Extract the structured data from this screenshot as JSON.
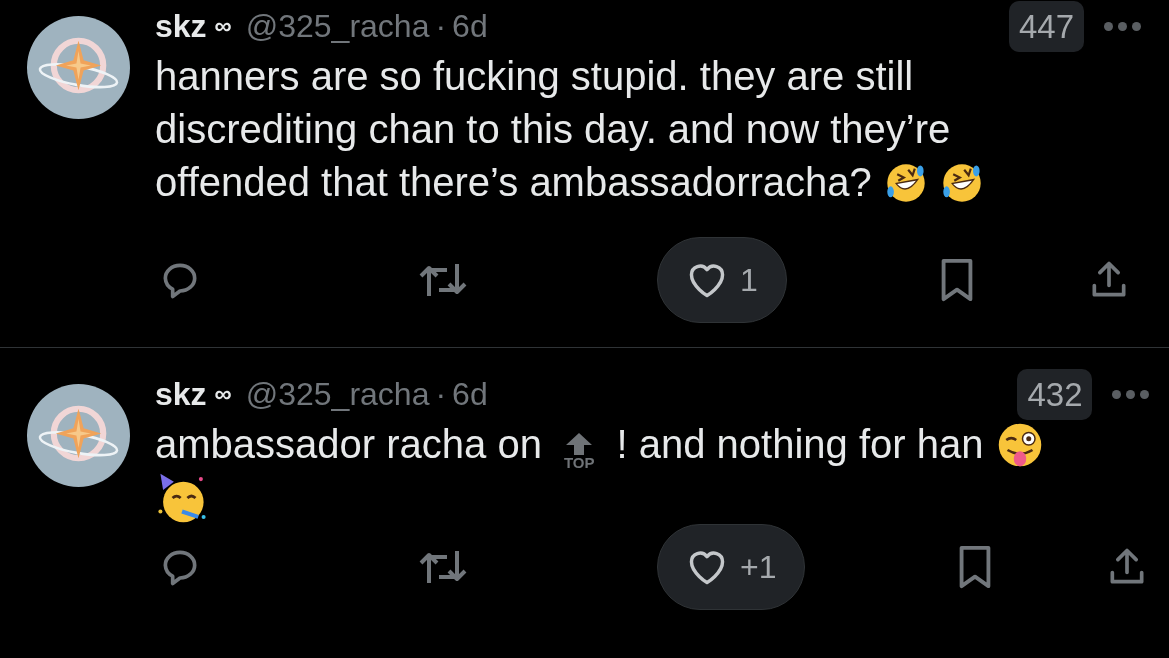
{
  "tweets": [
    {
      "display_name": "skz",
      "name_mark": "∞",
      "handle": "@325_racha",
      "separator": "·",
      "time": "6d",
      "badge": "447",
      "body_lines": [
        [
          {
            "kind": "text",
            "text": "hanners are so fucking stupid. they are still"
          }
        ],
        [
          {
            "kind": "text",
            "text": "discrediting chan to this day. and now they’re"
          }
        ],
        [
          {
            "kind": "text",
            "text": "offended that there’s ambassadorracha?"
          },
          {
            "kind": "laughing"
          },
          {
            "kind": "laughing"
          }
        ]
      ],
      "like_count": "1"
    },
    {
      "display_name": "skz",
      "name_mark": "∞",
      "handle": "@325_racha",
      "separator": "·",
      "time": "6d",
      "badge": "432",
      "body_lines": [
        [
          {
            "kind": "text",
            "text": "ambassador racha on"
          },
          {
            "kind": "top",
            "text": "TOP"
          },
          {
            "kind": "text",
            "text": "! and nothing for han"
          },
          {
            "kind": "winking"
          }
        ],
        [
          {
            "kind": "partying"
          }
        ]
      ],
      "like_count": "+1"
    }
  ]
}
